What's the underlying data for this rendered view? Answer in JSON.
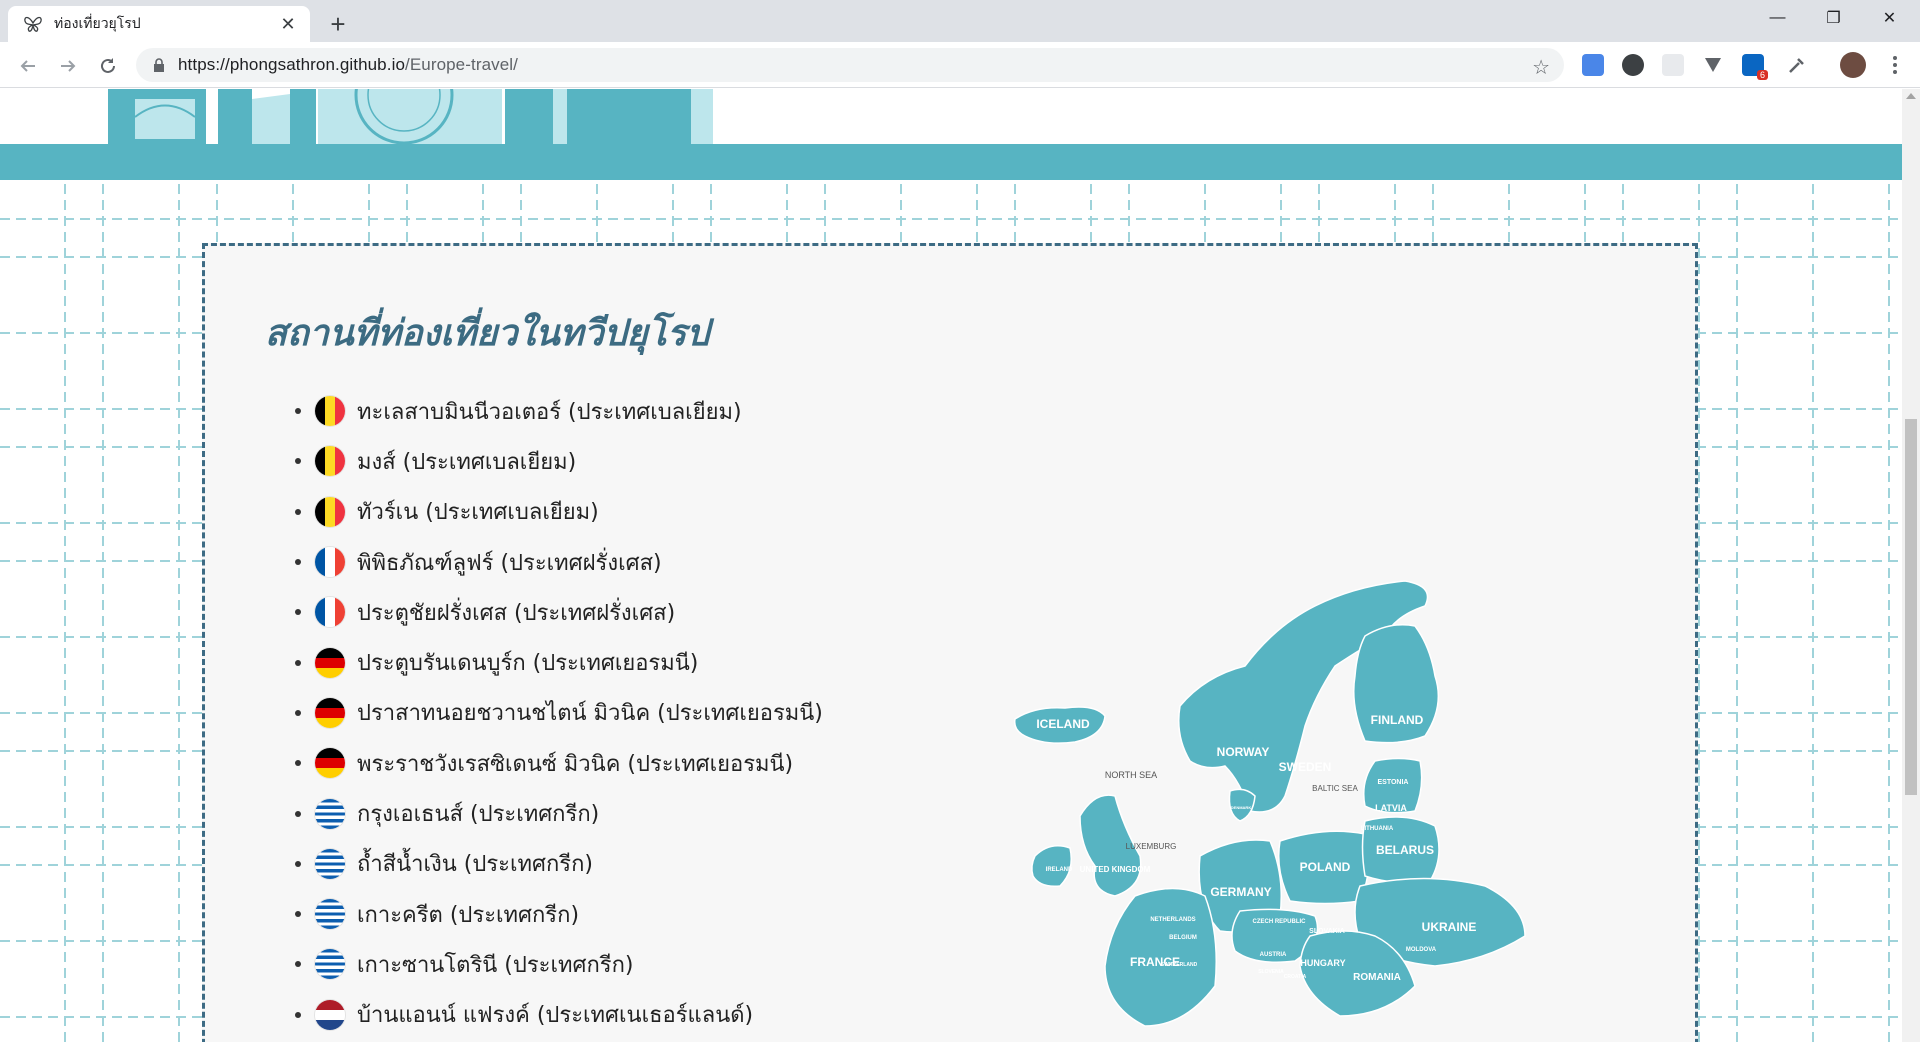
{
  "browser": {
    "tab_title": "ท่องเที่ยวยุโรป",
    "new_tab_symbol": "+",
    "close_symbol": "✕",
    "minimize_symbol": "—",
    "restore_symbol": "❐",
    "window_close_symbol": "✕",
    "url_host": "https://phongsathron.github.io",
    "url_path": "/Europe-travel/",
    "star_symbol": "☆",
    "linkedin_badge": "6"
  },
  "page": {
    "section_title": "สถานที่ท่องเที่ยวในทวีปยุโรป",
    "places": [
      {
        "text": "ทะเลสาบมินนีวอเตอร์ (ประเทศเบลเยียม)",
        "flag": "belgium"
      },
      {
        "text": "มงส์ (ประเทศเบลเยียม)",
        "flag": "belgium"
      },
      {
        "text": "ทัวร์เน (ประเทศเบลเยียม)",
        "flag": "belgium"
      },
      {
        "text": "พิพิธภัณฑ์ลูฟร์ (ประเทศฝรั่งเศส)",
        "flag": "france"
      },
      {
        "text": "ประตูชัยฝรั่งเศส (ประเทศฝรั่งเศส)",
        "flag": "france"
      },
      {
        "text": "ประตูบรันเดนบูร์ก (ประเทศเยอรมนี)",
        "flag": "germany"
      },
      {
        "text": "ปราสาทนอยชวานชไตน์ มิวนิค (ประเทศเยอรมนี)",
        "flag": "germany"
      },
      {
        "text": "พระราชวังเรสซิเดนซ์ มิวนิค (ประเทศเยอรมนี)",
        "flag": "germany"
      },
      {
        "text": "กรุงเอเธนส์ (ประเทศกรีก)",
        "flag": "greece"
      },
      {
        "text": "ถ้ำสีน้ำเงิน (ประเทศกรีก)",
        "flag": "greece"
      },
      {
        "text": "เกาะครีต (ประเทศกรีก)",
        "flag": "greece"
      },
      {
        "text": "เกาะซานโตรินี (ประเทศกรีก)",
        "flag": "greece"
      },
      {
        "text": "บ้านแอนน์ แฟรงค์ (ประเทศเนเธอร์แลนด์)",
        "flag": "netherlands"
      }
    ],
    "map_labels": {
      "iceland": "ICELAND",
      "norway": "NORWAY",
      "sweden": "SWEDEN",
      "finland": "FINLAND",
      "north_sea": "NORTH SEA",
      "baltic_sea": "BALTIC SEA",
      "estonia": "ESTONIA",
      "latvia": "LATVIA",
      "lithuania": "LITHUANIA",
      "denmark": "DENMARK",
      "luxemburg": "LUXEMBURG",
      "ireland": "IRELAND",
      "uk": "UNITED KINGDOM",
      "netherlands": "NETHERLANDS",
      "belgium": "BELGIUM",
      "germany": "GERMANY",
      "poland": "POLAND",
      "belarus": "BELARUS",
      "czech": "CZECH REPUBLIC",
      "slovakia": "SLOVAKIA",
      "ukraine": "UKRAINE",
      "austria": "AUSTRIA",
      "hungary": "HUNGARY",
      "france": "FRANCE",
      "switzerland": "SWITZERLAND",
      "slovenia": "SLOVENIA",
      "croatia": "CROATIA",
      "moldova": "MOLDOVA",
      "romania": "ROMANIA"
    }
  },
  "colors": {
    "accent": "#57b4c2",
    "title": "#3c6b82",
    "map_fill": "#57b4c2",
    "flag_colors": {
      "belgium": [
        "#000000",
        "#FDDA24",
        "#EF3340"
      ],
      "france": [
        "#0055A4",
        "#FFFFFF",
        "#EF4135"
      ],
      "germany": [
        "#000000",
        "#DD0000",
        "#FFCE00"
      ],
      "greece": [
        "#0D5EAF",
        "#FFFFFF"
      ],
      "netherlands": [
        "#AE1C28",
        "#FFFFFF",
        "#21468B"
      ]
    }
  }
}
